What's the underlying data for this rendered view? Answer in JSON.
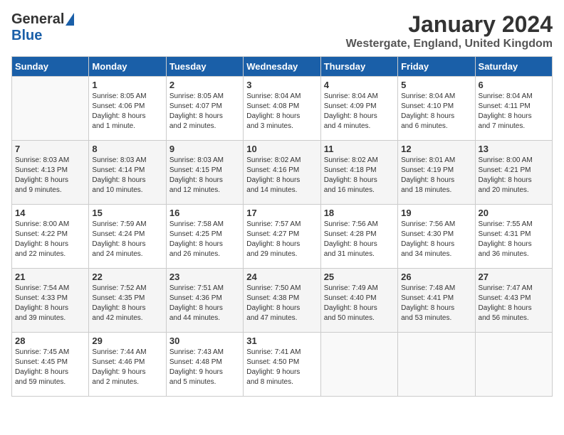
{
  "header": {
    "logo_general": "General",
    "logo_blue": "Blue",
    "month_title": "January 2024",
    "location": "Westergate, England, United Kingdom"
  },
  "weekdays": [
    "Sunday",
    "Monday",
    "Tuesday",
    "Wednesday",
    "Thursday",
    "Friday",
    "Saturday"
  ],
  "weeks": [
    [
      {
        "day": "",
        "info": ""
      },
      {
        "day": "1",
        "info": "Sunrise: 8:05 AM\nSunset: 4:06 PM\nDaylight: 8 hours\nand 1 minute."
      },
      {
        "day": "2",
        "info": "Sunrise: 8:05 AM\nSunset: 4:07 PM\nDaylight: 8 hours\nand 2 minutes."
      },
      {
        "day": "3",
        "info": "Sunrise: 8:04 AM\nSunset: 4:08 PM\nDaylight: 8 hours\nand 3 minutes."
      },
      {
        "day": "4",
        "info": "Sunrise: 8:04 AM\nSunset: 4:09 PM\nDaylight: 8 hours\nand 4 minutes."
      },
      {
        "day": "5",
        "info": "Sunrise: 8:04 AM\nSunset: 4:10 PM\nDaylight: 8 hours\nand 6 minutes."
      },
      {
        "day": "6",
        "info": "Sunrise: 8:04 AM\nSunset: 4:11 PM\nDaylight: 8 hours\nand 7 minutes."
      }
    ],
    [
      {
        "day": "7",
        "info": "Sunrise: 8:03 AM\nSunset: 4:13 PM\nDaylight: 8 hours\nand 9 minutes."
      },
      {
        "day": "8",
        "info": "Sunrise: 8:03 AM\nSunset: 4:14 PM\nDaylight: 8 hours\nand 10 minutes."
      },
      {
        "day": "9",
        "info": "Sunrise: 8:03 AM\nSunset: 4:15 PM\nDaylight: 8 hours\nand 12 minutes."
      },
      {
        "day": "10",
        "info": "Sunrise: 8:02 AM\nSunset: 4:16 PM\nDaylight: 8 hours\nand 14 minutes."
      },
      {
        "day": "11",
        "info": "Sunrise: 8:02 AM\nSunset: 4:18 PM\nDaylight: 8 hours\nand 16 minutes."
      },
      {
        "day": "12",
        "info": "Sunrise: 8:01 AM\nSunset: 4:19 PM\nDaylight: 8 hours\nand 18 minutes."
      },
      {
        "day": "13",
        "info": "Sunrise: 8:00 AM\nSunset: 4:21 PM\nDaylight: 8 hours\nand 20 minutes."
      }
    ],
    [
      {
        "day": "14",
        "info": "Sunrise: 8:00 AM\nSunset: 4:22 PM\nDaylight: 8 hours\nand 22 minutes."
      },
      {
        "day": "15",
        "info": "Sunrise: 7:59 AM\nSunset: 4:24 PM\nDaylight: 8 hours\nand 24 minutes."
      },
      {
        "day": "16",
        "info": "Sunrise: 7:58 AM\nSunset: 4:25 PM\nDaylight: 8 hours\nand 26 minutes."
      },
      {
        "day": "17",
        "info": "Sunrise: 7:57 AM\nSunset: 4:27 PM\nDaylight: 8 hours\nand 29 minutes."
      },
      {
        "day": "18",
        "info": "Sunrise: 7:56 AM\nSunset: 4:28 PM\nDaylight: 8 hours\nand 31 minutes."
      },
      {
        "day": "19",
        "info": "Sunrise: 7:56 AM\nSunset: 4:30 PM\nDaylight: 8 hours\nand 34 minutes."
      },
      {
        "day": "20",
        "info": "Sunrise: 7:55 AM\nSunset: 4:31 PM\nDaylight: 8 hours\nand 36 minutes."
      }
    ],
    [
      {
        "day": "21",
        "info": "Sunrise: 7:54 AM\nSunset: 4:33 PM\nDaylight: 8 hours\nand 39 minutes."
      },
      {
        "day": "22",
        "info": "Sunrise: 7:52 AM\nSunset: 4:35 PM\nDaylight: 8 hours\nand 42 minutes."
      },
      {
        "day": "23",
        "info": "Sunrise: 7:51 AM\nSunset: 4:36 PM\nDaylight: 8 hours\nand 44 minutes."
      },
      {
        "day": "24",
        "info": "Sunrise: 7:50 AM\nSunset: 4:38 PM\nDaylight: 8 hours\nand 47 minutes."
      },
      {
        "day": "25",
        "info": "Sunrise: 7:49 AM\nSunset: 4:40 PM\nDaylight: 8 hours\nand 50 minutes."
      },
      {
        "day": "26",
        "info": "Sunrise: 7:48 AM\nSunset: 4:41 PM\nDaylight: 8 hours\nand 53 minutes."
      },
      {
        "day": "27",
        "info": "Sunrise: 7:47 AM\nSunset: 4:43 PM\nDaylight: 8 hours\nand 56 minutes."
      }
    ],
    [
      {
        "day": "28",
        "info": "Sunrise: 7:45 AM\nSunset: 4:45 PM\nDaylight: 8 hours\nand 59 minutes."
      },
      {
        "day": "29",
        "info": "Sunrise: 7:44 AM\nSunset: 4:46 PM\nDaylight: 9 hours\nand 2 minutes."
      },
      {
        "day": "30",
        "info": "Sunrise: 7:43 AM\nSunset: 4:48 PM\nDaylight: 9 hours\nand 5 minutes."
      },
      {
        "day": "31",
        "info": "Sunrise: 7:41 AM\nSunset: 4:50 PM\nDaylight: 9 hours\nand 8 minutes."
      },
      {
        "day": "",
        "info": ""
      },
      {
        "day": "",
        "info": ""
      },
      {
        "day": "",
        "info": ""
      }
    ]
  ]
}
